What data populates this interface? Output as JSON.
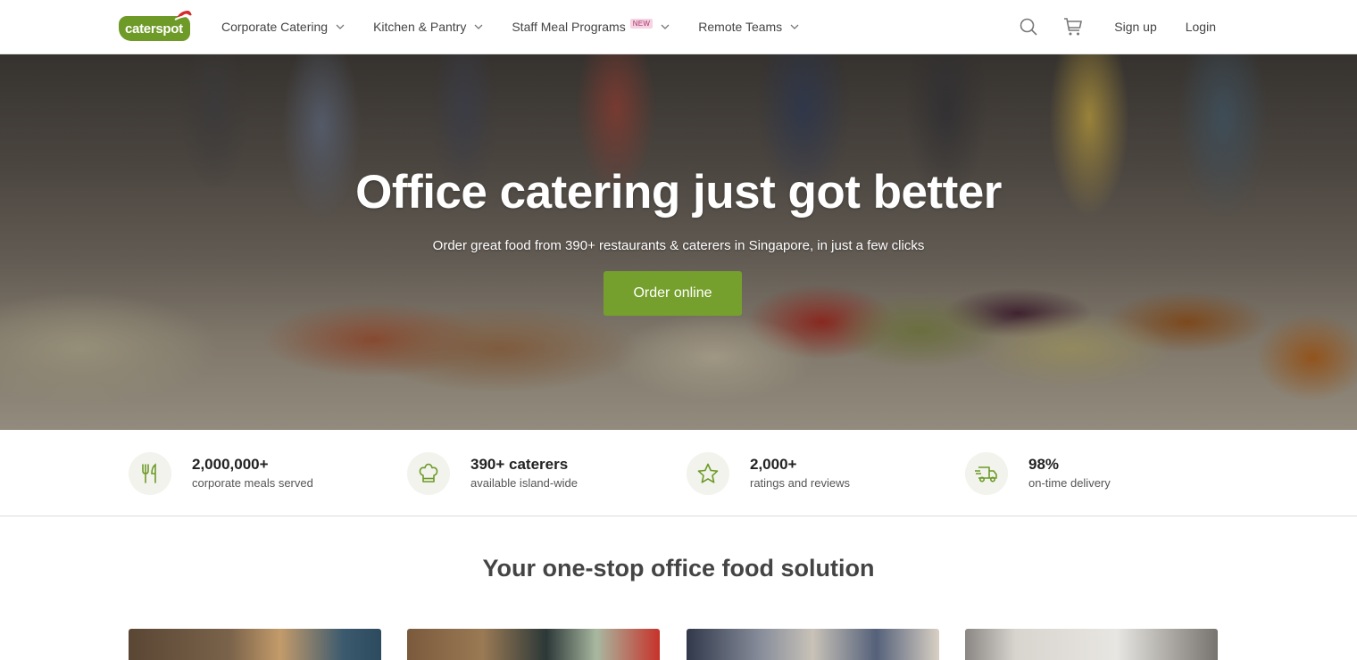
{
  "header": {
    "logo_text": "caterspot",
    "nav": [
      {
        "label": "Corporate Catering"
      },
      {
        "label": "Kitchen & Pantry"
      },
      {
        "label": "Staff Meal Programs",
        "badge": "NEW"
      },
      {
        "label": "Remote Teams"
      }
    ],
    "signup_label": "Sign up",
    "login_label": "Login"
  },
  "hero": {
    "title": "Office catering just got better",
    "subtitle": "Order great food from 390+ restaurants & caterers in Singapore, in just a few clicks",
    "cta_label": "Order online"
  },
  "stats": [
    {
      "icon": "cutlery-icon",
      "value": "2,000,000+",
      "label": "corporate meals served"
    },
    {
      "icon": "chef-hat-icon",
      "value": "390+ caterers",
      "label": "available island-wide"
    },
    {
      "icon": "star-icon",
      "value": "2,000+",
      "label": "ratings and reviews"
    },
    {
      "icon": "delivery-truck-icon",
      "value": "98%",
      "label": "on-time delivery"
    }
  ],
  "section": {
    "title": "Your one-stop office food solution"
  },
  "colors": {
    "brand_green": "#76a02d",
    "icon_green": "#6e9a27",
    "badge_pink": "#f6d2e2"
  }
}
